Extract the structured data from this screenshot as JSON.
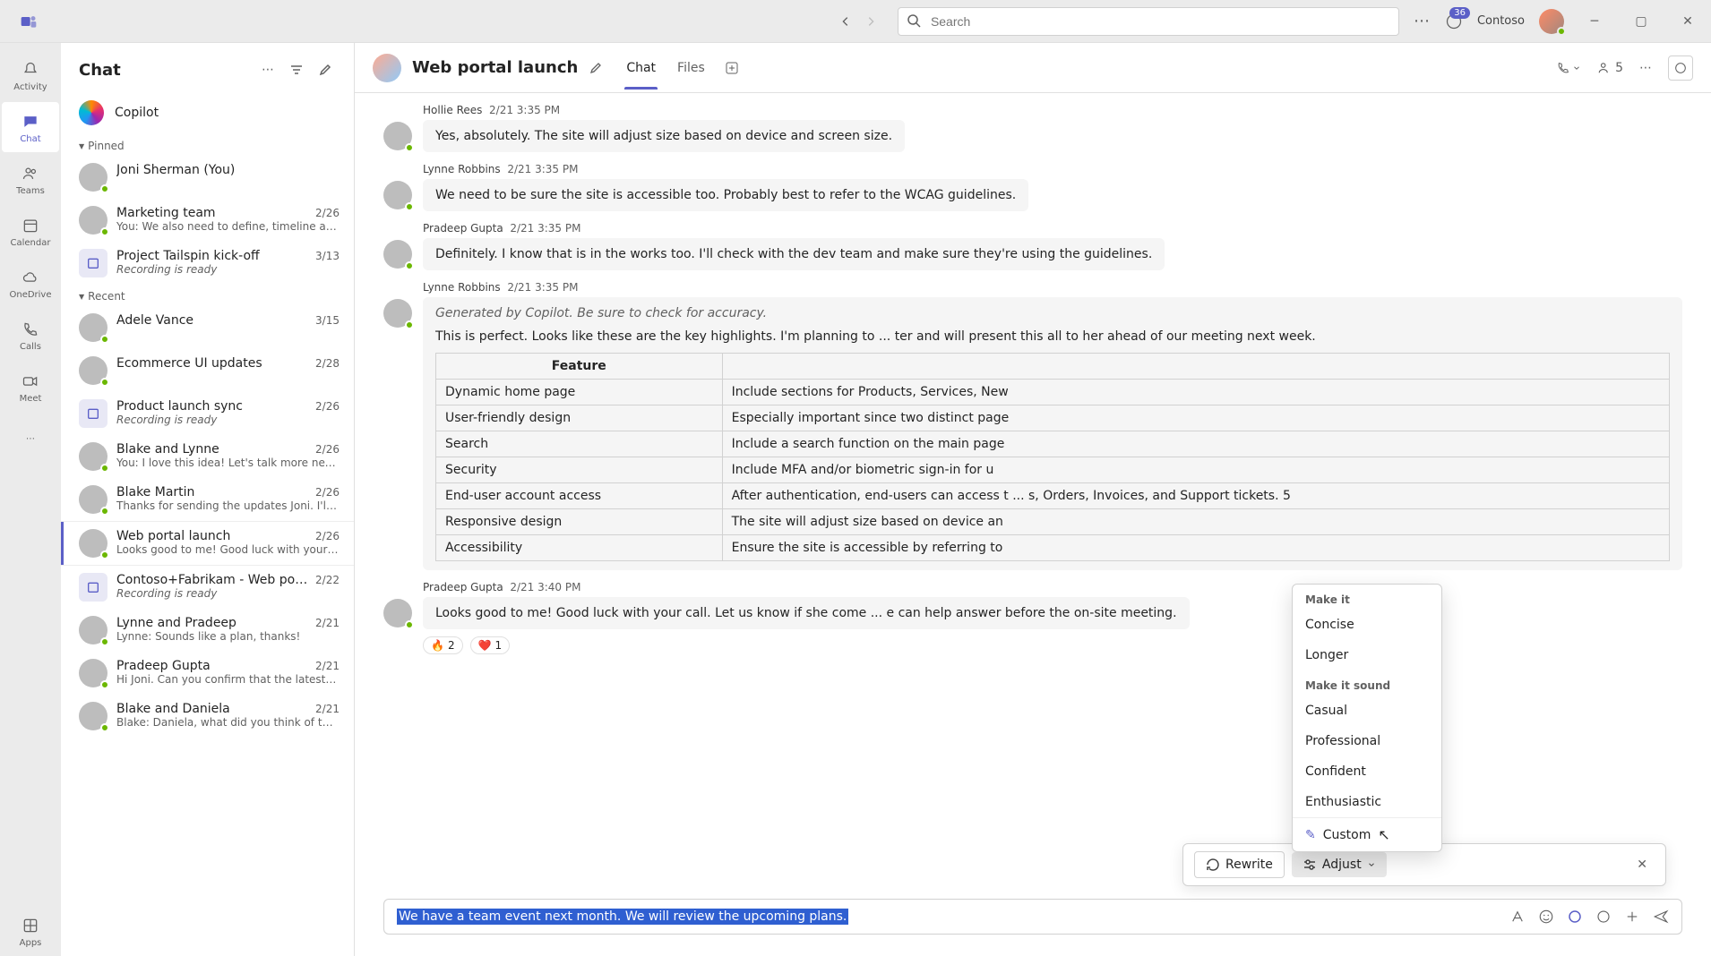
{
  "titlebar": {
    "search_placeholder": "Search",
    "notif_count": "36",
    "org_name": "Contoso"
  },
  "rail": [
    {
      "key": "activity",
      "label": "Activity"
    },
    {
      "key": "chat",
      "label": "Chat"
    },
    {
      "key": "teams",
      "label": "Teams"
    },
    {
      "key": "calendar",
      "label": "Calendar"
    },
    {
      "key": "onedrive",
      "label": "OneDrive"
    },
    {
      "key": "calls",
      "label": "Calls"
    },
    {
      "key": "meet",
      "label": "Meet"
    }
  ],
  "rail_apps": "Apps",
  "sidebar": {
    "title": "Chat",
    "copilot_label": "Copilot",
    "pinned_label": "Pinned",
    "recent_label": "Recent",
    "pinned": [
      {
        "title": "Joni Sherman (You)",
        "preview": "",
        "date": ""
      },
      {
        "title": "Marketing team",
        "preview": "You: We also need to define, timeline and miles...",
        "date": "2/26"
      },
      {
        "title": "Project Tailspin kick-off",
        "preview": "Recording is ready",
        "date": "3/13",
        "italic": true,
        "cal": true
      }
    ],
    "recent": [
      {
        "title": "Adele Vance",
        "preview": "",
        "date": "3/15"
      },
      {
        "title": "Ecommerce UI updates",
        "preview": "",
        "date": "2/28"
      },
      {
        "title": "Product launch sync",
        "preview": "Recording is ready",
        "date": "2/26",
        "italic": true,
        "cal": true
      },
      {
        "title": "Blake and Lynne",
        "preview": "You: I love this idea! Let's talk more next week.",
        "date": "2/26"
      },
      {
        "title": "Blake Martin",
        "preview": "Thanks for sending the updates Joni. I'll have s...",
        "date": "2/26"
      },
      {
        "title": "Web portal launch",
        "preview": "Looks good to me! Good luck with your call.",
        "date": "2/26",
        "active": true
      },
      {
        "title": "Contoso+Fabrikam - Web portal ki...",
        "preview": "Recording is ready",
        "date": "2/22",
        "italic": true,
        "cal": true
      },
      {
        "title": "Lynne and Pradeep",
        "preview": "Lynne: Sounds like a plan, thanks!",
        "date": "2/21"
      },
      {
        "title": "Pradeep Gupta",
        "preview": "Hi Joni. Can you confirm that the latest updates...",
        "date": "2/21"
      },
      {
        "title": "Blake and Daniela",
        "preview": "Blake: Daniela, what did you think of the new d...",
        "date": "2/21"
      }
    ]
  },
  "conversation": {
    "title": "Web portal launch",
    "tabs": {
      "chat": "Chat",
      "files": "Files"
    },
    "participant_count": "5",
    "messages": [
      {
        "author": "Hollie Rees",
        "time": "2/21 3:35 PM",
        "text": "Yes, absolutely. The site will adjust size based on device and screen size."
      },
      {
        "author": "Lynne Robbins",
        "time": "2/21 3:35 PM",
        "text": "We need to be sure the site is accessible too. Probably best to refer to the WCAG guidelines."
      },
      {
        "author": "Pradeep Gupta",
        "time": "2/21 3:35 PM",
        "text": "Definitely. I know that is in the works too. I'll check with the dev team and make sure they're using the guidelines."
      }
    ],
    "copilot_msg": {
      "author": "Lynne Robbins",
      "time": "2/21 3:35 PM",
      "generated_note": "Generated by Copilot. Be sure to check for accuracy.",
      "intro": "This is perfect. Looks like these are the key highlights. I'm planning to ... ter and will present this all to her ahead of our meeting next week.",
      "table_header": "Feature",
      "rows": [
        {
          "f": "Dynamic home page",
          "d": "Include sections for Products, Services, New"
        },
        {
          "f": "User-friendly design",
          "d": "Especially important since two distinct page"
        },
        {
          "f": "Search",
          "d": "Include a search function on the main page"
        },
        {
          "f": "Security",
          "d": "Include MFA and/or biometric sign-in for u"
        },
        {
          "f": "End-user account access",
          "d": "After authentication, end-users can access t ... s, Orders, Invoices, and Support tickets. 5"
        },
        {
          "f": "Responsive design",
          "d": "The site will adjust size based on device an"
        },
        {
          "f": "Accessibility",
          "d": "Ensure the site is accessible by referring to"
        }
      ]
    },
    "last_msg": {
      "author": "Pradeep Gupta",
      "time": "2/21 3:40 PM",
      "text": "Looks good to me! Good luck with your call. Let us know if she come ... e can help answer before the on-site meeting.",
      "reactions": [
        {
          "emoji": "🔥",
          "count": "2"
        },
        {
          "emoji": "❤️",
          "count": "1"
        }
      ]
    }
  },
  "adjust_menu": {
    "make_it": "Make it",
    "opts1": [
      "Concise",
      "Longer"
    ],
    "make_it_sound": "Make it sound",
    "opts2": [
      "Casual",
      "Professional",
      "Confident",
      "Enthusiastic"
    ],
    "custom": "Custom"
  },
  "copilot_bar": {
    "rewrite": "Rewrite",
    "adjust": "Adjust"
  },
  "compose": {
    "draft": "We have a team event next month. We will review the upcoming plans."
  }
}
